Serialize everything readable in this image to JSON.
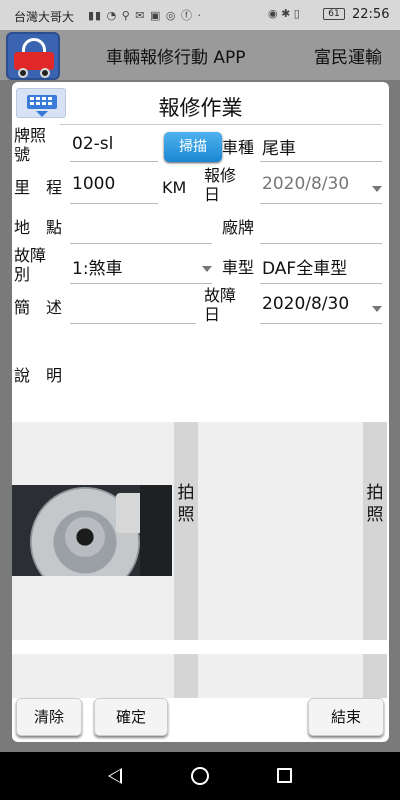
{
  "status_bar": {
    "carrier": "台灣大哥大",
    "battery": "61",
    "time": "22:56"
  },
  "app_bar": {
    "title": "車輛報修行動 APP",
    "company": "富民運輸"
  },
  "dialog": {
    "title": "報修作業",
    "scan_label": "掃描",
    "fields": {
      "plate": {
        "label": "牌照號",
        "value": "02-sl"
      },
      "vehicle_kind": {
        "label": "車種",
        "value": "尾車"
      },
      "mileage": {
        "label": "里　程",
        "value": "1000",
        "unit": "KM"
      },
      "report_date": {
        "label": "報修日",
        "value": "2020/8/30"
      },
      "location": {
        "label": "地　點",
        "value": ""
      },
      "factory_brand": {
        "label": "廠牌",
        "value": ""
      },
      "fault_type": {
        "label": "故障別",
        "value": "1:煞車"
      },
      "model": {
        "label": "車型",
        "value": "DAF全車型"
      },
      "summary": {
        "label": "簡　述",
        "value": ""
      },
      "fault_date": {
        "label": "故障日",
        "value": "2020/8/30"
      },
      "description": {
        "label": "說　明",
        "value": ""
      }
    },
    "photo_buttons": [
      "拍照",
      "拍照"
    ],
    "buttons": {
      "clear": "清除",
      "confirm": "確定",
      "end": "結束"
    }
  }
}
